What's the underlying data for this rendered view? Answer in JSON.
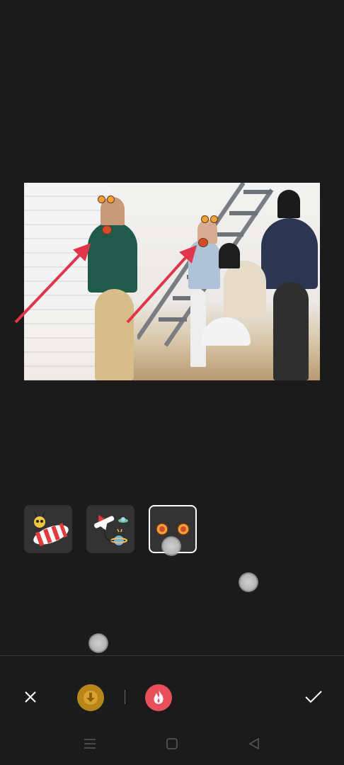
{
  "photo": {
    "description_label": ""
  },
  "sticker_tray": {
    "items": [
      {
        "icon": "alien-sausage-sticker-icon",
        "selected": false
      },
      {
        "icon": "airplane-planet-sticker-icon",
        "selected": false
      },
      {
        "icon": "bear-ears-sticker-icon",
        "selected": true
      }
    ]
  },
  "toolbar": {
    "close_icon": "close-icon",
    "download_icon": "download-icon",
    "effect_icon": "flame-effect-icon",
    "confirm_icon": "check-icon"
  },
  "nav": {
    "menu_icon": "menu-icon",
    "home_icon": "home-icon",
    "back_icon": "back-icon"
  },
  "colors": {
    "background": "#1b1b1b",
    "tray_bg": "#333333",
    "selected_border": "#ffffff",
    "download_accent": "#b8861c",
    "effect_accent": "#e8505b",
    "arrow": "#e0354b"
  }
}
